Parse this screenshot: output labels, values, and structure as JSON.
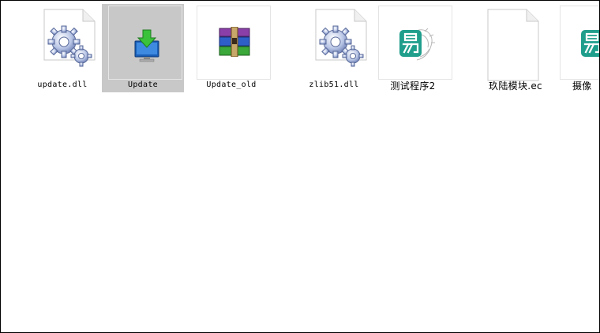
{
  "window": {
    "view": "thumbnails"
  },
  "files": [
    {
      "name": "update.dll",
      "icon": "gear-file-icon",
      "selected": false
    },
    {
      "name": "Update",
      "icon": "monitor-download-icon",
      "selected": true
    },
    {
      "name": "Update_old",
      "icon": "winrar-archive-icon",
      "selected": false
    },
    {
      "name": "zlib51.dll",
      "icon": "gear-file-icon",
      "selected": false
    },
    {
      "name": "测试程序2",
      "icon": "e-language-icon",
      "selected": false
    },
    {
      "name": "玖陆模块.ec",
      "icon": "blank-document-icon",
      "selected": false
    },
    {
      "name": "摄像",
      "icon": "e-language-icon",
      "selected": false
    }
  ],
  "colors": {
    "selection": "#c8c8c8",
    "border": "#000000",
    "e_icon": "#1f9e8c"
  }
}
